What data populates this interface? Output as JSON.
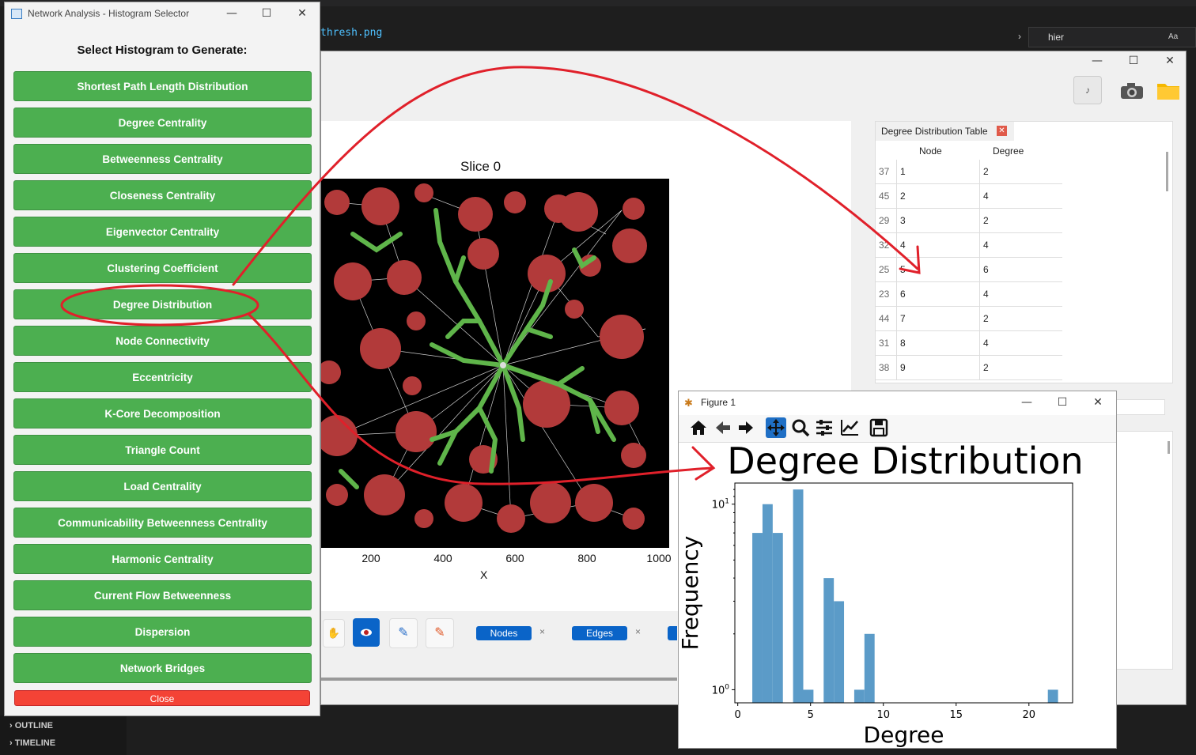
{
  "ide": {
    "filename": "thresh.png",
    "search_value": "hier",
    "search_opt": "Aa",
    "outline": "OUTLINE",
    "timeline": "TIMELINE"
  },
  "selector": {
    "window_title": "Network Analysis - Histogram Selector",
    "heading": "Select Histogram to Generate:",
    "buttons": [
      "Shortest Path Length Distribution",
      "Degree Centrality",
      "Betweenness Centrality",
      "Closeness Centrality",
      "Eigenvector Centrality",
      "Clustering Coefficient",
      "Degree Distribution",
      "Node Connectivity",
      "Eccentricity",
      "K-Core Decomposition",
      "Triangle Count",
      "Load Centrality",
      "Communicability Betweenness Centrality",
      "Harmonic Centrality",
      "Current Flow Betweenness",
      "Dispersion",
      "Network Bridges"
    ],
    "close_label": "Close",
    "colors": {
      "button": "#4caf50",
      "close": "#f44336"
    }
  },
  "main_app": {
    "slice_title": "Slice 0",
    "x_ticks": [
      "200",
      "400",
      "600",
      "800",
      "1000"
    ],
    "x_label": "X",
    "chips": [
      "Nodes",
      "Edges"
    ],
    "chip_close": "×",
    "table_tab": "Degree Distribution Table",
    "table_headers": [
      "Node",
      "Degree"
    ],
    "table_rows": [
      {
        "row": "37",
        "node": "1",
        "degree": "2"
      },
      {
        "row": "45",
        "node": "2",
        "degree": "4"
      },
      {
        "row": "29",
        "node": "3",
        "degree": "2"
      },
      {
        "row": "32",
        "node": "4",
        "degree": "4"
      },
      {
        "row": "25",
        "node": "5",
        "degree": "6"
      },
      {
        "row": "23",
        "node": "6",
        "degree": "4"
      },
      {
        "row": "44",
        "node": "7",
        "degree": "2"
      },
      {
        "row": "31",
        "node": "8",
        "degree": "4"
      },
      {
        "row": "38",
        "node": "9",
        "degree": "2"
      }
    ],
    "accent": "#0a64c8"
  },
  "figure": {
    "window_title": "Figure 1",
    "chart_data": {
      "type": "bar",
      "title": "Degree Distribution",
      "xlabel": "Degree",
      "ylabel": "Frequency",
      "yscale": "log",
      "x_ticks": [
        "0",
        "5",
        "10",
        "15",
        "20"
      ],
      "y_ticks": [
        "10^0",
        "10^1"
      ],
      "xlim": [
        -0.2,
        23
      ],
      "ylim": [
        0.85,
        13
      ],
      "bins": [
        {
          "x0": 1,
          "x1": 1.7,
          "count": 7
        },
        {
          "x0": 1.7,
          "x1": 2.4,
          "count": 10
        },
        {
          "x0": 2.4,
          "x1": 3.1,
          "count": 7
        },
        {
          "x0": 3.8,
          "x1": 4.5,
          "count": 12
        },
        {
          "x0": 4.5,
          "x1": 5.2,
          "count": 1
        },
        {
          "x0": 5.9,
          "x1": 6.6,
          "count": 4
        },
        {
          "x0": 6.6,
          "x1": 7.3,
          "count": 3
        },
        {
          "x0": 8,
          "x1": 8.7,
          "count": 1
        },
        {
          "x0": 8.7,
          "x1": 9.4,
          "count": 2
        },
        {
          "x0": 21.3,
          "x1": 22,
          "count": 1
        }
      ],
      "color": "#5b9bc8"
    }
  }
}
